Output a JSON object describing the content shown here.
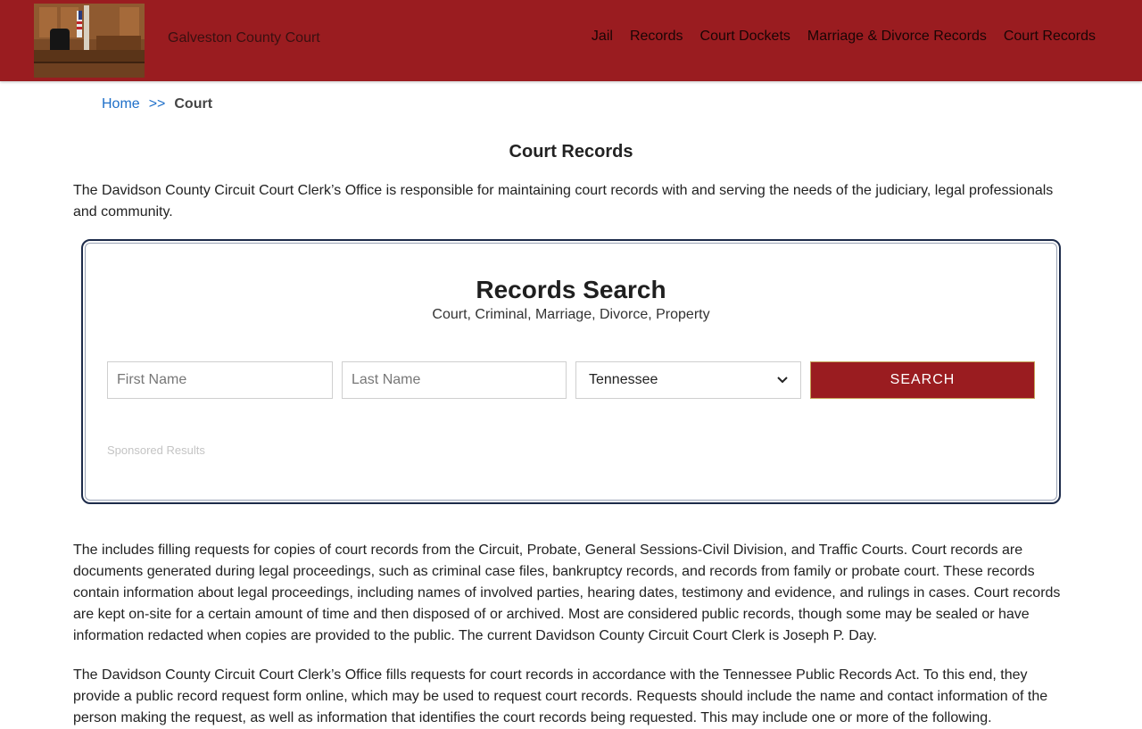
{
  "header": {
    "site_name": "Galveston County Court",
    "nav": [
      {
        "label": "Jail"
      },
      {
        "label": "Records"
      },
      {
        "label": "Court Dockets"
      },
      {
        "label": "Marriage & Divorce Records"
      },
      {
        "label": "Court Records"
      }
    ],
    "brand_color": "#9a1c20"
  },
  "breadcrumb": {
    "home": "Home",
    "separator": ">>",
    "current": "Court"
  },
  "page": {
    "title": "Court Records",
    "intro": "The Davidson County Circuit Court Clerk’s Office is responsible for maintaining court records with and serving the needs of the judiciary, legal professionals and community."
  },
  "search": {
    "title": "Records Search",
    "subtitle": "Court, Criminal, Marriage, Divorce, Property",
    "first_name_placeholder": "First Name",
    "last_name_placeholder": "Last Name",
    "state_selected": "Tennessee",
    "button_label": "SEARCH",
    "sponsored": "Sponsored Results"
  },
  "content": {
    "paragraph1": "The includes filling requests for copies of court records from the Circuit, Probate, General Sessions-Civil Division, and Traffic Courts. Court records are documents generated during legal proceedings, such as criminal case files, bankruptcy records, and records from family or probate court. These records contain information about legal proceedings, including names of involved parties, hearing dates, testimony and evidence, and rulings in cases. Court records are kept on-site for a certain amount of time and then disposed of or archived. Most are considered public records, though some may be sealed or have information redacted when copies are provided to the public. The current Davidson County Circuit Court Clerk is Joseph P. Day.",
    "paragraph2": "The Davidson County Circuit Court Clerk’s Office fills requests for court records in accordance with the Tennessee Public Records Act. To this end, they provide a public record request form online, which may be used to request court records. Requests should include the name and contact information of the person making the request, as well as information that identifies the court records being requested. This may include one or more of the following."
  }
}
